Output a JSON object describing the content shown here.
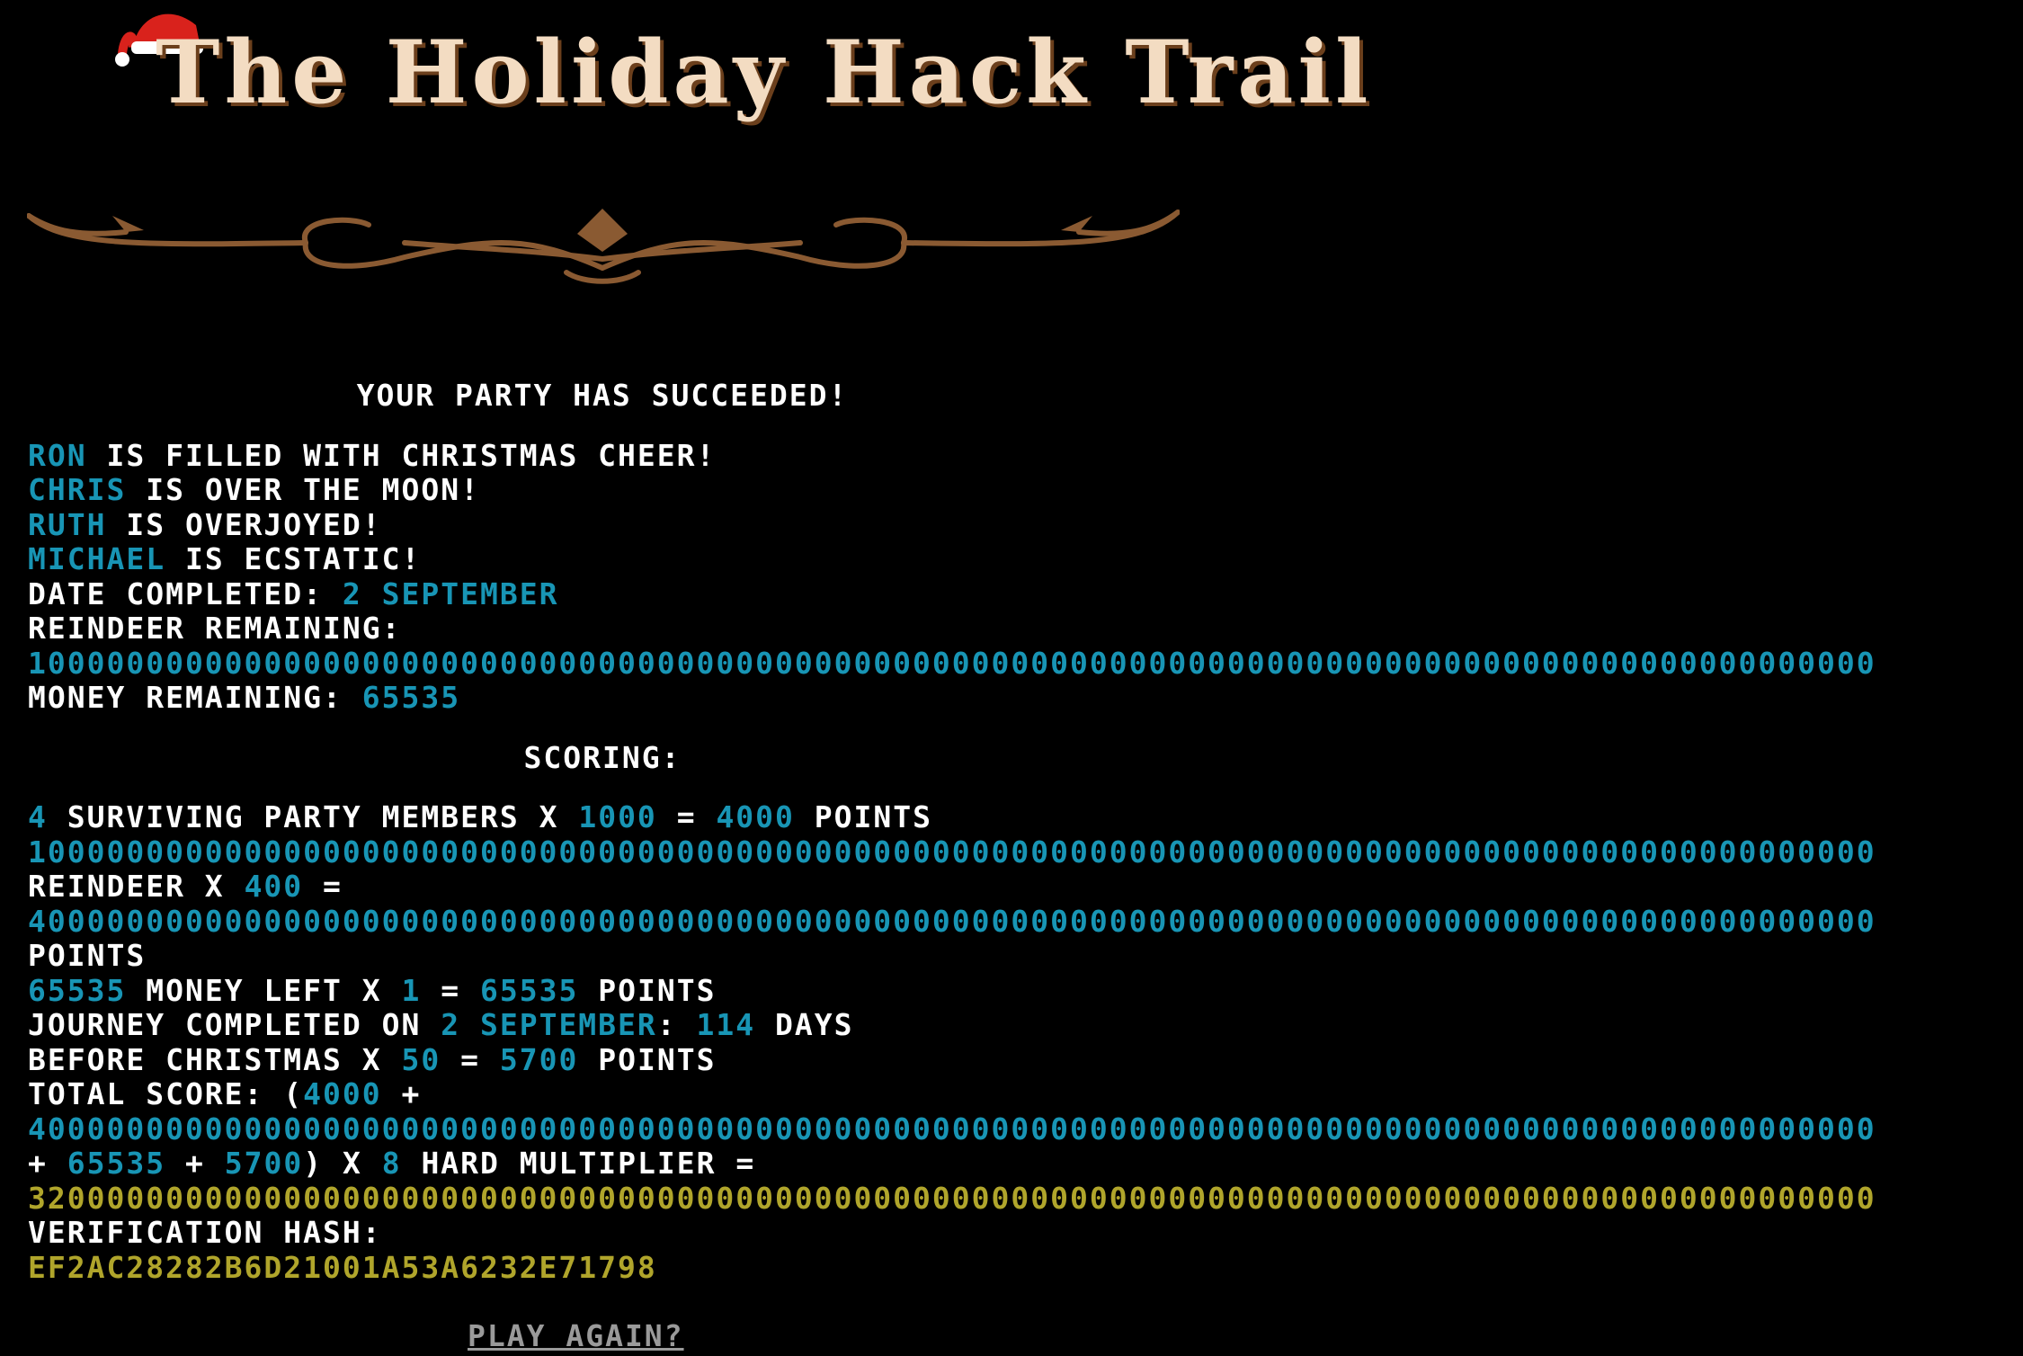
{
  "header": {
    "title": "The Holiday Hack Trail"
  },
  "results": {
    "heading": "YOUR PARTY HAS SUCCEEDED!",
    "party": [
      {
        "name": "RON",
        "status": "IS FILLED WITH CHRISTMAS CHEER!"
      },
      {
        "name": "CHRIS",
        "status": "IS OVER THE MOON!"
      },
      {
        "name": "RUTH",
        "status": "IS OVERJOYED!"
      },
      {
        "name": "MICHAEL",
        "status": "IS ECSTATIC!"
      }
    ],
    "date_label": "DATE COMPLETED:",
    "date_value": "2 SEPTEMBER",
    "reindeer_label": "REINDEER REMAINING:",
    "reindeer_value": "1000000000000000000000000000000000000000000000000000000000000000000000000000000000000000000000",
    "money_label": "MONEY REMAINING:",
    "money_value": "65535"
  },
  "scoring": {
    "heading": "SCORING:",
    "members_count": "4",
    "members_text": "SURVIVING PARTY MEMBERS X",
    "members_mult": "1000",
    "equals": "=",
    "members_points": "4000",
    "points_word": "POINTS",
    "reindeer_count": "1000000000000000000000000000000000000000000000000000000000000000000000000000000000000000000000",
    "reindeer_text": "REINDEER X",
    "reindeer_mult": "400",
    "reindeer_points": "4000000000000000000000000000000000000000000000000000000000000000000000000000000000000000000000",
    "money_count": "65535",
    "money_text": "MONEY LEFT X",
    "money_mult": "1",
    "money_points": "65535",
    "journey_text": "JOURNEY COMPLETED ON",
    "journey_date": "2 SEPTEMBER",
    "journey_colon": ":",
    "journey_days": "114",
    "days_word": "DAYS",
    "before_text": "BEFORE CHRISTMAS X",
    "before_mult": "50",
    "before_points": "5700",
    "total_label": "TOTAL SCORE: (",
    "total_a": "4000",
    "plus": "+",
    "total_b": "4000000000000000000000000000000000000000000000000000000000000000000000000000000000000000000000",
    "total_c": "65535",
    "total_d": "5700",
    "total_close": ") X",
    "multiplier": "8",
    "multiplier_text": "HARD MULTIPLIER =",
    "total_value": "3200000000000000000000000000000000000000000000000000000000000000000000000000000000000000000000",
    "hash_label": "VERIFICATION HASH:",
    "hash_value": "EF2AC28282B6D21001A53A6232E71798"
  },
  "actions": {
    "play_again": "PLAY AGAIN?"
  },
  "colors": {
    "background": "#000000",
    "text": "#ffffff",
    "highlight": "#1895b5",
    "gold": "#b0a52b",
    "title": "#f3dcc2",
    "ornament": "#8a5a32",
    "link": "#9a9a9a"
  }
}
